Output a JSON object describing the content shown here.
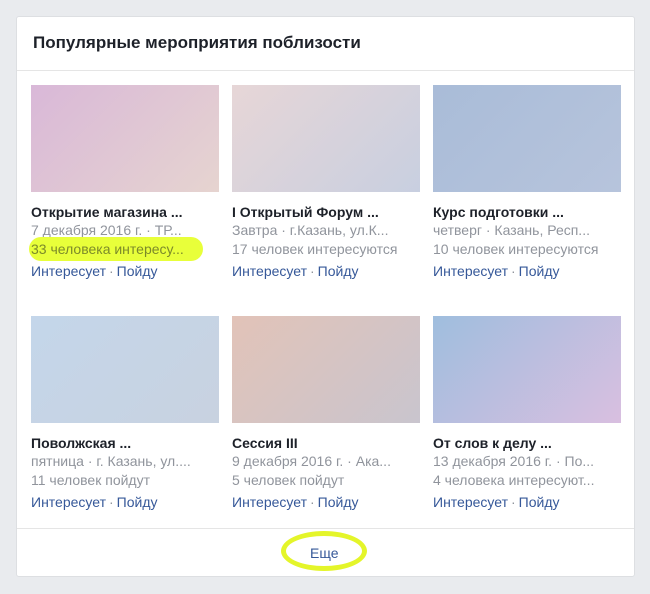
{
  "section": {
    "title": "Популярные мероприятия поблизости"
  },
  "events": [
    {
      "title": "Открытие магазина ...",
      "subtitle": "7 декабря 2016 г. · ТР...",
      "count": "33 человека интересу...",
      "highlighted": true,
      "interested_label": "Интересует",
      "going_label": "Пойду",
      "gradient": [
        "#d9b8d8",
        "#e6d4d0"
      ]
    },
    {
      "title": "I Открытый Форум ...",
      "subtitle": "Завтра · г.Казань, ул.К...",
      "count": "17 человек интересуются",
      "interested_label": "Интересует",
      "going_label": "Пойду",
      "gradient": [
        "#e7d6d7",
        "#c8cfe0"
      ]
    },
    {
      "title": "Курс подготовки ...",
      "subtitle": "четверг · Казань, Респ...",
      "count": "10 человек интересуются",
      "interested_label": "Интересует",
      "going_label": "Пойду",
      "gradient": [
        "#a9bcd8",
        "#b7c4dc"
      ]
    },
    {
      "title": "Поволжская ...",
      "subtitle": "пятница · г. Казань, ул....",
      "count": "11 человек пойдут",
      "interested_label": "Интересует",
      "going_label": "Пойду",
      "gradient": [
        "#c4d6ea",
        "#c8d2e0"
      ]
    },
    {
      "title": "Сессия III",
      "subtitle": "9 декабря 2016 г. · Ака...",
      "count": "5 человек пойдут",
      "interested_label": "Интересует",
      "going_label": "Пойду",
      "gradient": [
        "#e2c3b8",
        "#c9c5ce"
      ]
    },
    {
      "title": "От слов к делу ...",
      "subtitle": "13 декабря 2016 г. · По...",
      "count": "4 человека интересуют...",
      "interested_label": "Интересует",
      "going_label": "Пойду",
      "gradient": [
        "#9fbede",
        "#d9bfe0"
      ]
    }
  ],
  "footer": {
    "more_label": "Еще"
  }
}
